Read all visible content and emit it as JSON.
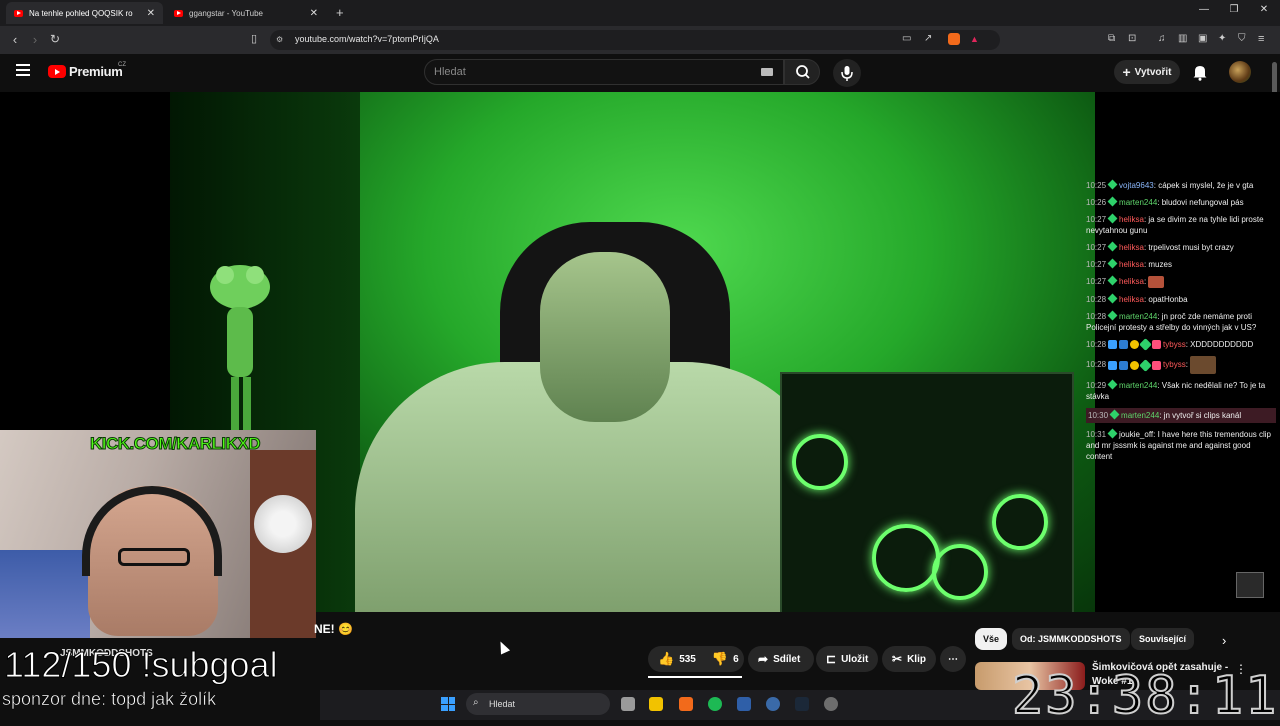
{
  "browser": {
    "tabs": [
      {
        "title": "Na tenhle pohled QOQSIK ro"
      },
      {
        "title": "ggangstar - YouTube"
      }
    ],
    "url": "youtube.com/watch?v=7ptomPrIjQA"
  },
  "header": {
    "logo_text": "Premium",
    "country": "CZ",
    "search_placeholder": "Hledat",
    "create_label": "Vytvořit"
  },
  "chat": {
    "messages": [
      {
        "time": "10:25",
        "user": "vojta9643",
        "text": "cápek si myslel, že je v gta"
      },
      {
        "time": "10:26",
        "user": "marten244",
        "text": "bludovi nefungoval pás"
      },
      {
        "time": "10:27",
        "user": "heliksa",
        "text": "ja se divim ze na tyhle lidi proste nevytahnou gunu"
      },
      {
        "time": "10:27",
        "user": "heliksa",
        "text": "trpelivost musi byt crazy"
      },
      {
        "time": "10:27",
        "user": "heliksa",
        "text": "muzes"
      },
      {
        "time": "10:27",
        "user": "heliksa",
        "text": ""
      },
      {
        "time": "10:28",
        "user": "heliksa",
        "text": "opatHonba"
      },
      {
        "time": "10:28",
        "user": "marten244",
        "text": "jn proč zde nemáme proti Policejní protesty a střelby do vinných jak v US?"
      },
      {
        "time": "10:28",
        "user": "tybyss",
        "text": "XDDDDDDDDDD"
      },
      {
        "time": "10:28",
        "user": "tybyss",
        "text": ""
      },
      {
        "time": "10:29",
        "user": "marten244",
        "text": "Však nic nedělali ne? To je ta stávka"
      },
      {
        "time": "10:30",
        "user": "marten244",
        "text": "jn vytvoř si clips kanál"
      },
      {
        "time": "10:31",
        "user": "joukie_off",
        "text": "I have here this tremendous clip and mr jsssmk is against me and against good content"
      }
    ]
  },
  "overlay": {
    "kick_url": "KICK.COM/KARLIKXD",
    "subgoal": "112/150 !subgoal",
    "sponsor": "sponzor dne: topd jak žolík",
    "clock": "23:38:11"
  },
  "video": {
    "title_fragment": "NE! 😊",
    "channel_partial": "JSMMKODDSHOTS"
  },
  "actions": {
    "likes": "535",
    "dislikes": "6",
    "share": "Sdílet",
    "save": "Uložit",
    "clip": "Klip"
  },
  "chips": [
    "Vše",
    "Od: JSMMKODDSHOTS",
    "Související"
  ],
  "recommendation": {
    "title": "Šimkovičová opět zasahuje -",
    "subtitle": "Woke #13"
  },
  "taskbar": {
    "search_label": "Hledat"
  }
}
